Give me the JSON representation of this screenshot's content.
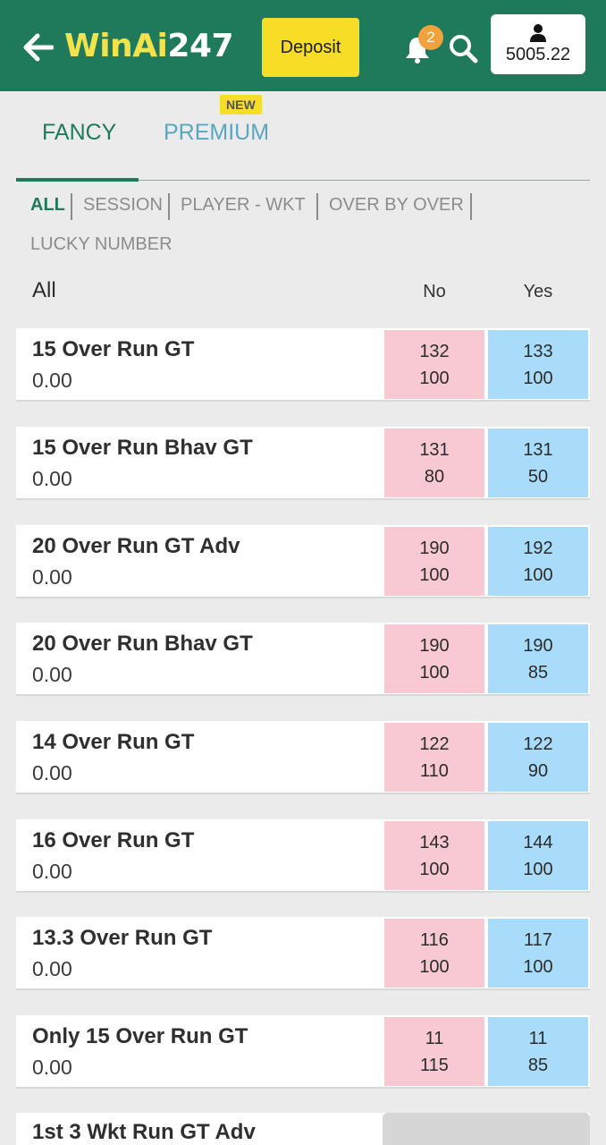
{
  "header": {
    "logo_win": "Win",
    "logo_ai": "Ai",
    "logo_num": "247",
    "deposit_label": "Deposit",
    "notification_count": "2",
    "balance": "5005.22",
    "colors": {
      "bar": "#1f7a5b",
      "deposit": "#f7dd26",
      "badge": "#f2a23c"
    }
  },
  "tabs": {
    "fancy": "FANCY",
    "premium": "PREMIUM",
    "new_badge": "NEW"
  },
  "filters": [
    "ALL",
    "SESSION",
    "PLAYER - WKT",
    "OVER BY OVER",
    "LUCKY NUMBER"
  ],
  "table_header": {
    "title": "All",
    "no": "No",
    "yes": "Yes"
  },
  "markets": [
    {
      "name": "15 Over Run GT",
      "value": "0.00",
      "no_odds": "132",
      "no_size": "100",
      "yes_odds": "133",
      "yes_size": "100"
    },
    {
      "name": "15 Over Run Bhav GT",
      "value": "0.00",
      "no_odds": "131",
      "no_size": "80",
      "yes_odds": "131",
      "yes_size": "50"
    },
    {
      "name": "20 Over Run GT Adv",
      "value": "0.00",
      "no_odds": "190",
      "no_size": "100",
      "yes_odds": "192",
      "yes_size": "100"
    },
    {
      "name": "20 Over Run Bhav GT",
      "value": "0.00",
      "no_odds": "190",
      "no_size": "100",
      "yes_odds": "190",
      "yes_size": "85"
    },
    {
      "name": "14 Over Run GT",
      "value": "0.00",
      "no_odds": "122",
      "no_size": "110",
      "yes_odds": "122",
      "yes_size": "90"
    },
    {
      "name": "16 Over Run GT",
      "value": "0.00",
      "no_odds": "143",
      "no_size": "100",
      "yes_odds": "144",
      "yes_size": "100"
    },
    {
      "name": "13.3 Over Run GT",
      "value": "0.00",
      "no_odds": "116",
      "no_size": "100",
      "yes_odds": "117",
      "yes_size": "100"
    },
    {
      "name": "Only 15 Over Run GT",
      "value": "0.00",
      "no_odds": "11",
      "no_size": "115",
      "yes_odds": "11",
      "yes_size": "85"
    },
    {
      "name": "1st 3 Wkt Run GT Adv"
    }
  ],
  "cell_colors": {
    "no": "#f8c9d3",
    "yes": "#a9dbfa"
  }
}
